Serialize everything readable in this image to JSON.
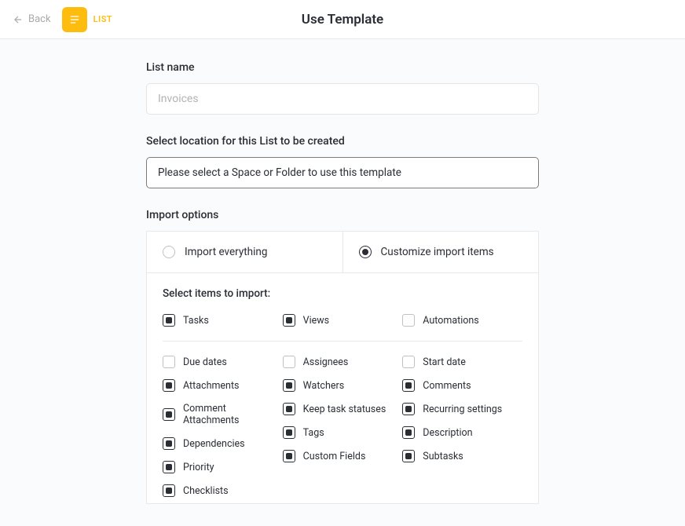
{
  "header": {
    "back": "Back",
    "badge": "LIST",
    "title": "Use Template"
  },
  "listName": {
    "label": "List name",
    "placeholder": "Invoices"
  },
  "location": {
    "label": "Select location for this List to be created",
    "placeholder": "Please select a Space or Folder to use this template"
  },
  "import": {
    "label": "Import options",
    "radioAll": "Import everything",
    "radioCustom": "Customize import items",
    "selectLabel": "Select items to import:",
    "top": [
      {
        "k": "tasks",
        "l": "Tasks",
        "c": true
      },
      {
        "k": "views",
        "l": "Views",
        "c": true
      },
      {
        "k": "automations",
        "l": "Automations",
        "c": false
      }
    ],
    "colA": [
      {
        "k": "duedates",
        "l": "Due dates",
        "c": false
      },
      {
        "k": "attachments",
        "l": "Attachments",
        "c": true
      },
      {
        "k": "commentattach",
        "l": "Comment Attachments",
        "c": true
      },
      {
        "k": "dependencies",
        "l": "Dependencies",
        "c": true
      },
      {
        "k": "priority",
        "l": "Priority",
        "c": true
      },
      {
        "k": "checklists",
        "l": "Checklists",
        "c": true
      }
    ],
    "colB": [
      {
        "k": "assignees",
        "l": "Assignees",
        "c": false
      },
      {
        "k": "watchers",
        "l": "Watchers",
        "c": true
      },
      {
        "k": "keepstatus",
        "l": "Keep task statuses",
        "c": true
      },
      {
        "k": "tags",
        "l": "Tags",
        "c": true
      },
      {
        "k": "customfields",
        "l": "Custom Fields",
        "c": true
      }
    ],
    "colC": [
      {
        "k": "startdate",
        "l": "Start date",
        "c": false
      },
      {
        "k": "comments",
        "l": "Comments",
        "c": true
      },
      {
        "k": "recurring",
        "l": "Recurring settings",
        "c": true
      },
      {
        "k": "description",
        "l": "Description",
        "c": true
      },
      {
        "k": "subtasks",
        "l": "Subtasks",
        "c": true
      }
    ]
  }
}
